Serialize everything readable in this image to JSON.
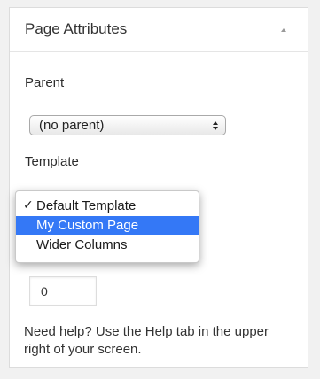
{
  "metabox": {
    "title": "Page Attributes",
    "toggle_icon": "caret-up-icon"
  },
  "parent": {
    "label": "Parent",
    "selected": "(no parent)",
    "stepper_icon": "select-stepper-icon"
  },
  "template": {
    "label": "Template",
    "options": [
      {
        "label": "Default Template",
        "checked": true,
        "highlighted": false
      },
      {
        "label": "My Custom Page",
        "checked": false,
        "highlighted": true
      },
      {
        "label": "Wider Columns",
        "checked": false,
        "highlighted": false
      }
    ],
    "check_glyph": "✓"
  },
  "order": {
    "value": "0"
  },
  "help": {
    "text": "Need help? Use the Help tab in the upper right of your screen."
  },
  "colors": {
    "highlight": "#3478f6",
    "background": "#f1f1f1"
  }
}
